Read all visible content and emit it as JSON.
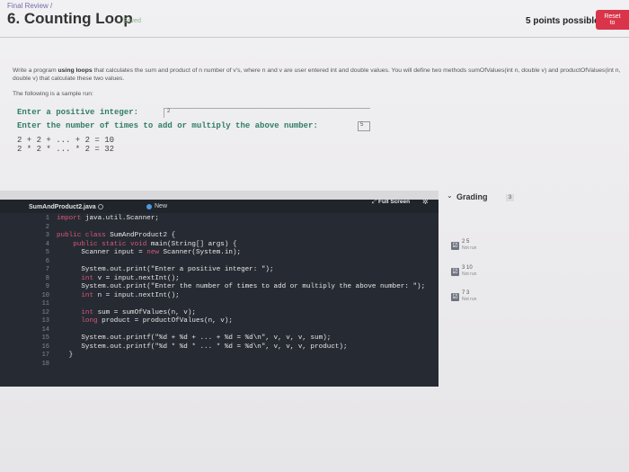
{
  "breadcrumb": "Final Review /",
  "title": "6. Counting Loop",
  "saved": "Saved",
  "points": "5 points possible",
  "reset_label": "Reset to",
  "description": {
    "prefix": "Write a program ",
    "bold": "using loops",
    "rest": " that calculates the sum and product of n number of v's, where n and v are user entered int and double values. You will define two methods sumOfValues(int n, double v) and productOfValues(int n, double v) that calculate these two values."
  },
  "sample_label": "The following is a sample run:",
  "sample": {
    "prompt1": "Enter a positive integer:",
    "input1": "2",
    "prompt2": "Enter the number of times to add or multiply the above number:",
    "input2": "5",
    "out1": "2 + 2 + ... + 2 = 10",
    "out2": "2 * 2 * ... * 2 = 32"
  },
  "editor": {
    "file_name": "SumAndProduct2.java",
    "new_label": "New",
    "full_screen_label": "Full Screen",
    "line_numbers": [
      "1",
      "2",
      "3",
      "4",
      "5",
      "6",
      "7",
      "8",
      "9",
      "10",
      "11",
      "12",
      "13",
      "14",
      "15",
      "16",
      "17",
      "18"
    ]
  },
  "grading": {
    "label": "Grading",
    "badge": "3",
    "tests": [
      {
        "value": "2 5",
        "status": "Not run"
      },
      {
        "value": "3 10",
        "status": "Not run"
      },
      {
        "value": "7 3",
        "status": "Not run"
      }
    ]
  },
  "colors": {
    "accent": "#d9344a",
    "keyword": "#d8567a",
    "editor_bg": "#262b33",
    "prompt_text": "#2f7d67"
  }
}
